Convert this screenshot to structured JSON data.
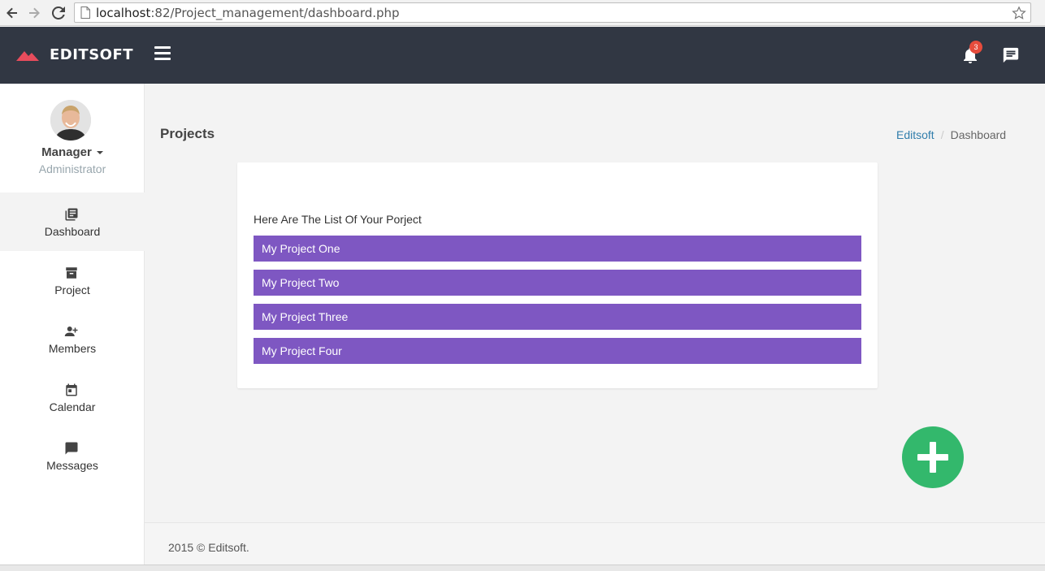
{
  "browser": {
    "url_host": "localhost",
    "url_rest": ":82/Project_management/dashboard.php"
  },
  "topbar": {
    "brand": "EDITSOFT",
    "notification_count": "3",
    "colors": {
      "bar": "#313743",
      "logo": "#e74c5c",
      "badge": "#e74c3c"
    }
  },
  "sidebar": {
    "user_name": "Manager",
    "user_role": "Administrator",
    "items": [
      {
        "label": "Dashboard",
        "icon": "dashboard-icon",
        "active": true
      },
      {
        "label": "Project",
        "icon": "archive-icon"
      },
      {
        "label": "Members",
        "icon": "user-plus-icon"
      },
      {
        "label": "Calendar",
        "icon": "calendar-icon"
      },
      {
        "label": "Messages",
        "icon": "message-icon"
      }
    ]
  },
  "main": {
    "title": "Projects",
    "breadcrumb": {
      "link": "Editsoft",
      "separator": "/",
      "current": "Dashboard"
    },
    "card": {
      "intro": "Here Are The List Of Your Porject",
      "projects": [
        "My Project One",
        "My Project Two",
        "My Project Three",
        "My Project Four"
      ],
      "row_color": "#7e57c2"
    },
    "fab_color": "#33b86c"
  },
  "footer": {
    "text": "2015 © Editsoft."
  }
}
